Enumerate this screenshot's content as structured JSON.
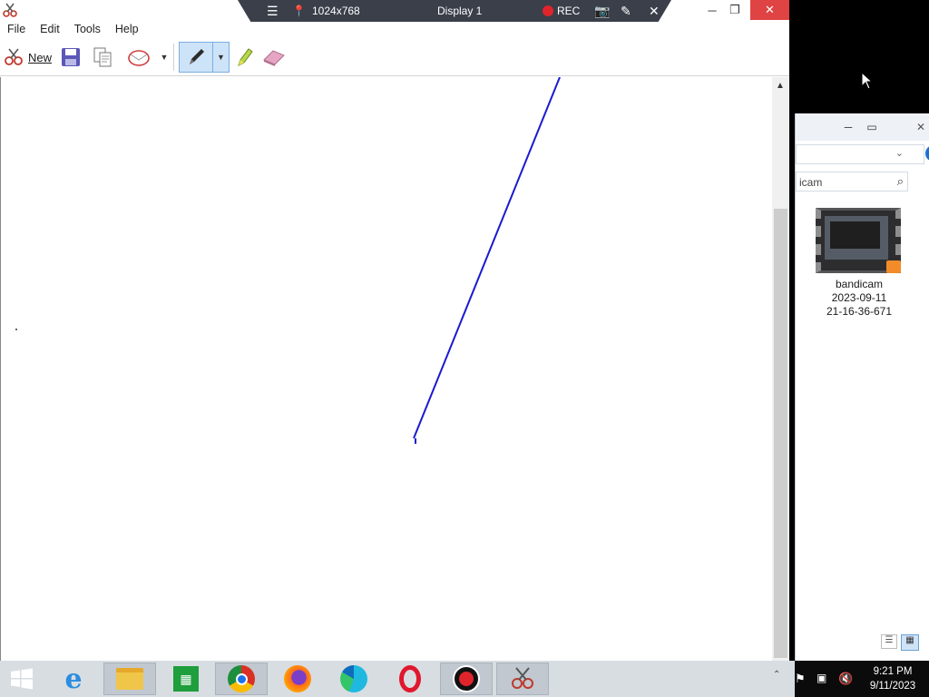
{
  "snipping_tool": {
    "menu": [
      "File",
      "Edit",
      "Tools",
      "Help"
    ],
    "toolbar": {
      "new_label": "New"
    }
  },
  "bandicam": {
    "resolution": "1024x768",
    "display": "Display 1",
    "rec": "REC"
  },
  "explorer": {
    "search_text": "icam",
    "file": {
      "line1": "bandicam",
      "line2": "2023-09-11",
      "line3": "21-16-36-671"
    }
  },
  "taskbar": {
    "time": "9:21 PM",
    "date": "9/11/2023",
    "apps": [
      "Start",
      "Internet Explorer",
      "File Explorer",
      "Store",
      "Google Chrome",
      "Firefox",
      "Microsoft Edge",
      "Opera",
      "Bandicam",
      "Snipping Tool"
    ]
  },
  "colors": {
    "pen_stroke": "#1a1ad0",
    "rec_dot": "#e0242b",
    "bandicam_bar": "#3a3f4a"
  }
}
